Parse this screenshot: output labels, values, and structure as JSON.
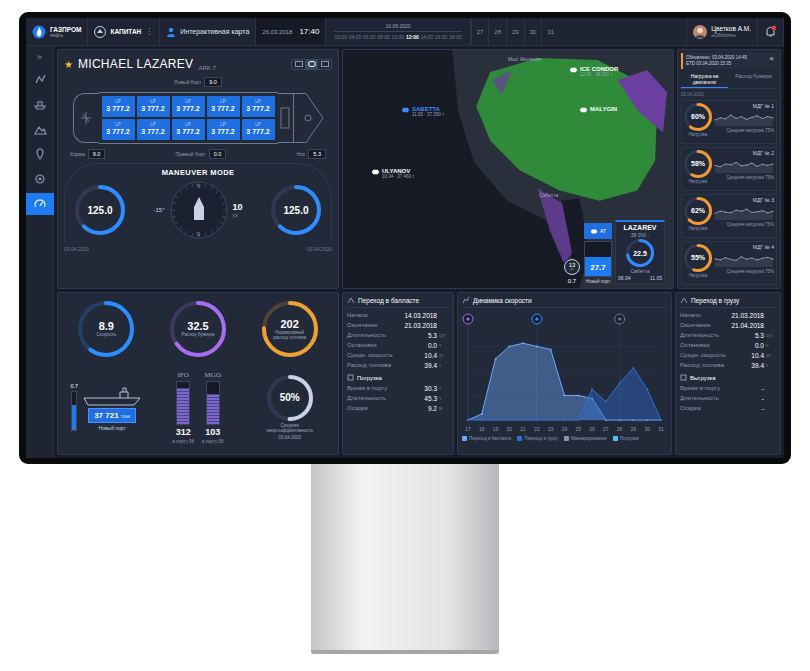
{
  "topbar": {
    "logo": "ГАЗПРОМ",
    "logo_sub": "нефть",
    "app": "КАПИТАН",
    "menu": "⋮",
    "section": "Интерактивная карта",
    "date": "26.03.2018",
    "time": "17:40",
    "timeline": {
      "date": "10.09.2020",
      "ticks": [
        {
          "label": "02:00",
          "selected": false
        },
        {
          "label": "04:00",
          "selected": false
        },
        {
          "label": "06:00",
          "selected": false
        },
        {
          "label": "08:00",
          "selected": false
        },
        {
          "label": "10:00",
          "selected": false
        },
        {
          "label": "12:00",
          "selected": true
        },
        {
          "label": "14:00",
          "selected": false
        },
        {
          "label": "16:00",
          "selected": false
        },
        {
          "label": "18:00",
          "selected": false
        }
      ]
    },
    "days": [
      "27",
      "28",
      "29",
      "30",
      "31"
    ],
    "user": {
      "name": "Цветков А.М.",
      "role": "«Offshore»"
    },
    "alert": true
  },
  "sidebar": {
    "toggle": "»",
    "items": [
      {
        "selected": false
      },
      {
        "selected": false
      },
      {
        "selected": false
      },
      {
        "selected": false
      },
      {
        "selected": false
      },
      {
        "selected": true
      }
    ]
  },
  "ship": {
    "star": "★",
    "name": "MICHAEL LAZAREV",
    "class": "ARK 7",
    "views": [
      {
        "selected": false
      },
      {
        "selected": true
      },
      {
        "selected": false
      }
    ],
    "left": {
      "label": "Левый борт",
      "value": "9.0"
    },
    "stern": {
      "label": "Корма",
      "value": "9.0"
    },
    "right": {
      "label": "Правый борт",
      "value": "0.0"
    },
    "bow": {
      "label": "Нос",
      "value": "5.3"
    },
    "tanks": [
      {
        "tag": "LP",
        "value": "3 777.2"
      },
      {
        "tag": "LP",
        "value": "3 777.2"
      },
      {
        "tag": "LP",
        "value": "3 777.2"
      },
      {
        "tag": "LP",
        "value": "3 777.2"
      },
      {
        "tag": "LP",
        "value": "3 777.2"
      },
      {
        "tag": "LP",
        "value": "3 777.2"
      },
      {
        "tag": "LP",
        "value": "3 777.2"
      },
      {
        "tag": "LP",
        "value": "3 777.2"
      },
      {
        "tag": "LP",
        "value": "3 777.2"
      },
      {
        "tag": "LP",
        "value": "3 777.2"
      }
    ],
    "mode": "MANEUVER MODE",
    "engines": [
      {
        "value": "125.0",
        "level": 0.62
      },
      {
        "value": "125.0",
        "level": 0.62
      }
    ],
    "compass": {
      "north": "N",
      "south": "S",
      "rudder": "-15°",
      "speed": "10",
      "unit": "уз"
    },
    "date": "03.04.2020",
    "stamp": "03.04.2020"
  },
  "map": {
    "places": [
      "Мыс Желания",
      "Сабетта"
    ],
    "ships": [
      {
        "name": "ICE CONDOR",
        "info": "12.40 · 38 250 т",
        "color": "#ffffff"
      },
      {
        "name": "MALYGIN",
        "color": "#ffffff"
      },
      {
        "name": "SABETTA",
        "info": "11.00 · 37 250 т",
        "color": "#3d8cff"
      },
      {
        "name": "ULYANOV",
        "info": "10.34 · 37 460 т",
        "color": "#ffffff"
      }
    ]
  },
  "vessel": {
    "tab": "AT",
    "draft": "27.7",
    "draft_label": "Новый порт",
    "draft_level": 0.55,
    "name": "LAZAREV",
    "capacity": "38 000 -",
    "speed": "22.5",
    "speed_level": 0.72,
    "speed_label": "Сабетта",
    "count": "13",
    "count_unit": "уз",
    "side": "0.7",
    "from": "06.04",
    "to": "11.05"
  },
  "notice": {
    "updated": "Обновлено: 03.04.2020 14:45",
    "etd": "ETD 03.04.2020 15:35",
    "close": "×"
  },
  "engines": {
    "tabs": [
      {
        "label": "Нагрузка на двигатели",
        "selected": true
      },
      {
        "label": "Расход бункера",
        "selected": false
      }
    ],
    "date": "03.04.2020",
    "items": [
      {
        "name": "МДГ № 1",
        "value": "60%",
        "level": 0.6,
        "caption": "Нагрузка",
        "avg": "Средняя нагрузка 75%",
        "series": [
          40,
          55,
          48,
          72,
          50,
          62,
          45,
          58,
          68,
          50,
          63,
          55
        ]
      },
      {
        "name": "МДГ № 2",
        "value": "58%",
        "level": 0.58,
        "caption": "Нагрузка",
        "avg": "Средняя нагрузка 75%",
        "series": [
          50,
          42,
          60,
          55,
          70,
          48,
          52,
          66,
          45,
          58,
          50,
          60
        ]
      },
      {
        "name": "МДГ № 3",
        "value": "62%",
        "level": 0.62,
        "caption": "Нагрузка",
        "avg": "Средняя нагрузка 75%",
        "series": [
          45,
          60,
          52,
          48,
          66,
          58,
          72,
          50,
          55,
          62,
          48,
          58
        ]
      },
      {
        "name": "МДГ № 4",
        "value": "55%",
        "level": 0.55,
        "caption": "Нагрузка",
        "avg": "Средняя нагрузка 75%",
        "series": [
          55,
          48,
          62,
          50,
          45,
          68,
          52,
          60,
          47,
          58,
          64,
          52
        ]
      }
    ]
  },
  "metrics": {
    "gauges": [
      {
        "value": "8.9",
        "label": "Скорость",
        "level": 0.6,
        "color": "#2f8cff"
      },
      {
        "value": "32.5",
        "label": "Расход бункера",
        "level": 0.65,
        "color": "#a86cf0"
      },
      {
        "value": "202",
        "label": "Нормативный расход топлива",
        "level": 0.75,
        "color": "#f0a030"
      }
    ],
    "hull": {
      "value": "37 721",
      "unit": "тонн",
      "port": "Новый порт",
      "side": "0.7",
      "level": 0.65
    },
    "fuel": [
      {
        "label": "IFO",
        "value": "312",
        "sub": "в порту 58",
        "level": 0.85
      },
      {
        "label": "MGO",
        "value": "103",
        "sub": "в порту 58",
        "level": 0.7
      }
    ],
    "efficiency": {
      "value": "50%",
      "label": "Средняя энергоэффективность",
      "date": "03.04.2020",
      "level": 0.5
    }
  },
  "ballast": {
    "title": "Переход в балласте",
    "rows": [
      {
        "label": "Начало",
        "value": "14.03.2018"
      },
      {
        "label": "Окончание",
        "value": "21.03.2018"
      },
      {
        "label": "Длительность",
        "value": "5.3",
        "unit": "сут"
      },
      {
        "label": "Остановки",
        "value": "0.0",
        "unit": "ч"
      },
      {
        "label": "Средн. скорость",
        "value": "10.4",
        "unit": "уз"
      },
      {
        "label": "Расход топлива",
        "value": "39.4",
        "unit": "т"
      }
    ],
    "section": "Погрузка",
    "section_rows": [
      {
        "label": "Время в порту",
        "value": "30.3",
        "unit": "ч"
      },
      {
        "label": "Длительность",
        "value": "45.3",
        "unit": "ч"
      },
      {
        "label": "Осадка",
        "value": "9.2",
        "unit": "м"
      }
    ]
  },
  "cargo": {
    "title": "Переход в грузу",
    "rows": [
      {
        "label": "Начало",
        "value": "21.03.2018"
      },
      {
        "label": "Окончание",
        "value": "21.04.2018"
      },
      {
        "label": "Длительность",
        "value": "5.3",
        "unit": "сут"
      },
      {
        "label": "Остановки",
        "value": "0.0",
        "unit": "ч"
      },
      {
        "label": "Средн. скорость",
        "value": "10.4",
        "unit": "уз"
      },
      {
        "label": "Расход топлива",
        "value": "39.4",
        "unit": "т"
      }
    ],
    "section": "Выгрузка",
    "section_rows": [
      {
        "label": "Время в порту",
        "value": "-"
      },
      {
        "label": "Длительность",
        "value": "-"
      },
      {
        "label": "Осадка",
        "value": "-"
      }
    ]
  },
  "chart": {
    "title": "Динамика скорости",
    "x_ticks": [
      "17",
      "18",
      "19",
      "20",
      "21",
      "22",
      "23",
      "24",
      "25",
      "26",
      "27",
      "28",
      "29",
      "30",
      "31"
    ],
    "series": [
      {
        "color": "#6fa8ff",
        "values": [
          0,
          1,
          10,
          12,
          12.5,
          12,
          11.5,
          4,
          4,
          3.5,
          0,
          0,
          0,
          0,
          0
        ]
      },
      {
        "color": "#2f6fd6",
        "values": [
          0,
          0,
          0,
          0,
          0,
          0,
          0,
          0,
          0,
          5,
          3,
          6,
          8.5,
          5,
          0
        ]
      }
    ],
    "legend": [
      {
        "label": "Переход в балласте",
        "color": "#6fa8ff"
      },
      {
        "label": "Переход в грузу",
        "color": "#2f6fd6"
      },
      {
        "label": "Маневрирование",
        "color": "#8a94a8"
      },
      {
        "label": "Погрузка",
        "color": "#4fc3f7"
      }
    ]
  }
}
